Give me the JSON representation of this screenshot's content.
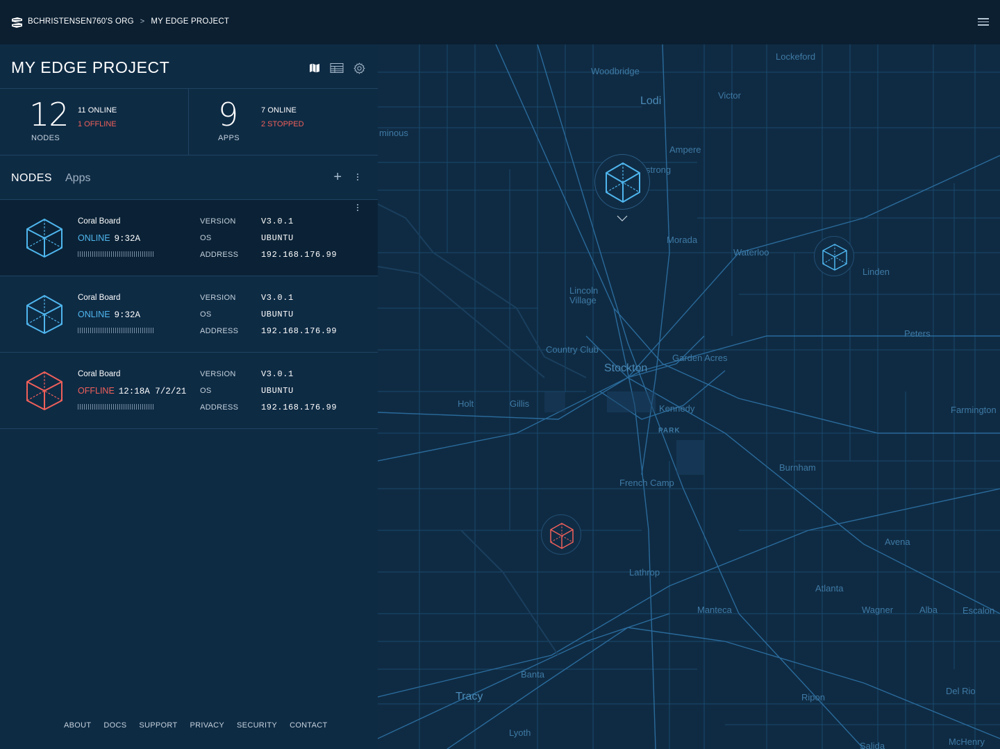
{
  "breadcrumb": {
    "org": "BCHRISTENSEN760'S ORG",
    "separator": ">",
    "project": "MY EDGE PROJECT"
  },
  "header": {
    "title": "MY EDGE PROJECT",
    "icons": [
      "map-icon",
      "table-icon",
      "gear-icon"
    ]
  },
  "stats": {
    "nodes": {
      "count": "12",
      "label": "NODES",
      "online": "11 ONLINE",
      "offline": "1 OFFLINE"
    },
    "apps": {
      "count": "9",
      "label": "APPS",
      "online": "7 ONLINE",
      "stopped": "2 STOPPED"
    }
  },
  "tabs": [
    {
      "label": "NODES",
      "active": true
    },
    {
      "label": "Apps",
      "active": false
    }
  ],
  "nodes": [
    {
      "name": "Coral Board",
      "status": "ONLINE",
      "time": "9:32A",
      "version_label": "VERSION",
      "version": "V3.0.1",
      "os_label": "OS",
      "os": "UBUNTU",
      "address_label": "ADDRESS",
      "address": "192.168.176.99",
      "selected": true
    },
    {
      "name": "Coral Board",
      "status": "ONLINE",
      "time": "9:32A",
      "version_label": "VERSION",
      "version": "V3.0.1",
      "os_label": "OS",
      "os": "UBUNTU",
      "address_label": "ADDRESS",
      "address": "192.168.176.99",
      "selected": false
    },
    {
      "name": "Coral Board",
      "status": "OFFLINE",
      "time": "12:18A 7/2/21",
      "version_label": "VERSION",
      "version": "V3.0.1",
      "os_label": "OS",
      "os": "UBUNTU",
      "address_label": "ADDRESS",
      "address": "192.168.176.99",
      "selected": false
    }
  ],
  "footer": {
    "links": [
      "ABOUT",
      "DOCS",
      "SUPPORT",
      "PRIVACY",
      "SECURITY",
      "CONTACT"
    ]
  },
  "map": {
    "places": [
      "Lockeford",
      "Woodbridge",
      "Lodi",
      "Victor",
      "minous",
      "Ampere",
      "strong",
      "Morada",
      "Waterloo",
      "Linden",
      "Lincoln Village",
      "Country Club",
      "Stockton",
      "Garden Acres",
      "Peters",
      "Holt",
      "Gillis",
      "Kennedy",
      "PARK",
      "Farmington",
      "Burnham",
      "French Camp",
      "Avena",
      "Lathrop",
      "Atlanta",
      "Manteca",
      "Wagner",
      "Alba",
      "Escalon",
      "Banta",
      "Tracy",
      "Ripon",
      "Del Rio",
      "Lyoth",
      "McHenry",
      "Salida"
    ],
    "markers": [
      {
        "status": "online",
        "selected": true
      },
      {
        "status": "online",
        "selected": false
      },
      {
        "status": "offline",
        "selected": false
      }
    ]
  },
  "colors": {
    "online": "#4fb6ee",
    "offline": "#f0605a",
    "panel": "#0e2b44",
    "map_bg": "#0f2b43",
    "road": "#1e5078"
  }
}
